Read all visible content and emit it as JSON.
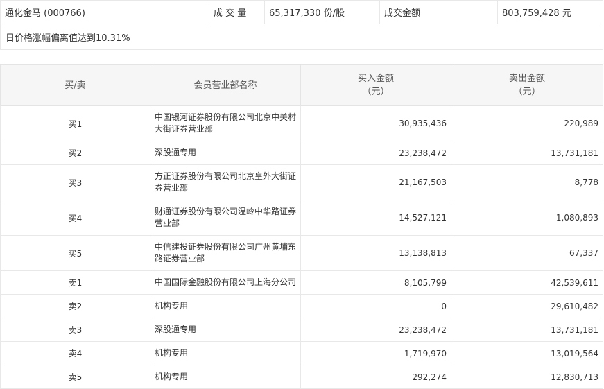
{
  "summary": {
    "stock": "通化金马 (000766)",
    "volume_label": "成 交 量",
    "volume_value": "65,317,330 份/股",
    "amount_label": "成交金额",
    "amount_value": "803,759,428 元",
    "reason": "日价格涨幅偏离值达到10.31%"
  },
  "table": {
    "headers": {
      "side": "买/卖",
      "broker": "会员营业部名称",
      "buy_line1": "买入金额",
      "buy_line2": "（元）",
      "sell_line1": "卖出金额",
      "sell_line2": "（元）"
    },
    "rows": [
      {
        "side": "买1",
        "broker": "中国银河证券股份有限公司北京中关村大街证券营业部",
        "buy": "30,935,436",
        "sell": "220,989"
      },
      {
        "side": "买2",
        "broker": "深股通专用",
        "buy": "23,238,472",
        "sell": "13,731,181"
      },
      {
        "side": "买3",
        "broker": "方正证券股份有限公司北京皇外大街证券营业部",
        "buy": "21,167,503",
        "sell": "8,778"
      },
      {
        "side": "买4",
        "broker": "财通证券股份有限公司温岭中华路证券营业部",
        "buy": "14,527,121",
        "sell": "1,080,893"
      },
      {
        "side": "买5",
        "broker": "中信建投证券股份有限公司广州黄埔东路证券营业部",
        "buy": "13,138,813",
        "sell": "67,337"
      },
      {
        "side": "卖1",
        "broker": "中国国际金融股份有限公司上海分公司",
        "buy": "8,105,799",
        "sell": "42,539,611"
      },
      {
        "side": "卖2",
        "broker": "机构专用",
        "buy": "0",
        "sell": "29,610,482"
      },
      {
        "side": "卖3",
        "broker": "深股通专用",
        "buy": "23,238,472",
        "sell": "13,731,181"
      },
      {
        "side": "卖4",
        "broker": "机构专用",
        "buy": "1,719,970",
        "sell": "13,019,564"
      },
      {
        "side": "卖5",
        "broker": "机构专用",
        "buy": "292,274",
        "sell": "12,830,713"
      }
    ]
  }
}
